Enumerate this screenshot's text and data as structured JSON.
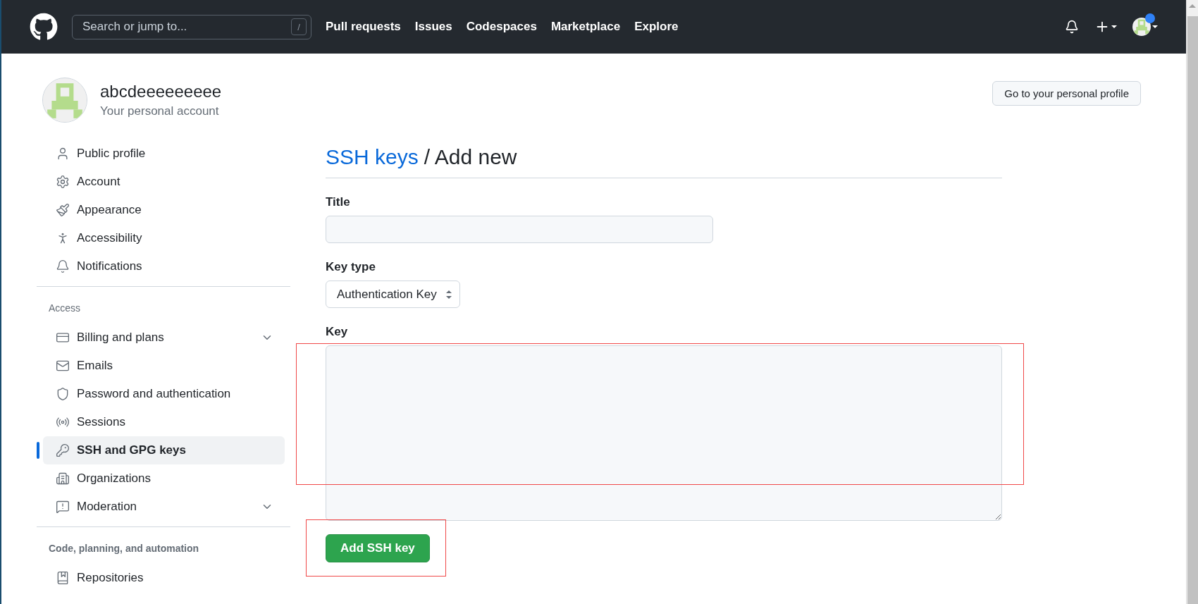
{
  "header": {
    "search": {
      "placeholder": "Search or jump to...",
      "shortcut": "/"
    },
    "nav": [
      "Pull requests",
      "Issues",
      "Codespaces",
      "Marketplace",
      "Explore"
    ],
    "notification_dot": true
  },
  "account": {
    "name": "abcdeeeeeeeee",
    "subtitle": "Your personal account",
    "profile_button": "Go to your personal profile"
  },
  "sidebar": {
    "sections": [
      {
        "items": [
          {
            "label": "Public profile",
            "selected": false,
            "expandable": false
          },
          {
            "label": "Account",
            "selected": false,
            "expandable": false
          },
          {
            "label": "Appearance",
            "selected": false,
            "expandable": false
          },
          {
            "label": "Accessibility",
            "selected": false,
            "expandable": false
          },
          {
            "label": "Notifications",
            "selected": false,
            "expandable": false
          }
        ]
      },
      {
        "heading": "Access",
        "items": [
          {
            "label": "Billing and plans",
            "selected": false,
            "expandable": true
          },
          {
            "label": "Emails",
            "selected": false,
            "expandable": false
          },
          {
            "label": "Password and authentication",
            "selected": false,
            "expandable": false
          },
          {
            "label": "Sessions",
            "selected": false,
            "expandable": false
          },
          {
            "label": "SSH and GPG keys",
            "selected": true,
            "expandable": false
          },
          {
            "label": "Organizations",
            "selected": false,
            "expandable": false
          },
          {
            "label": "Moderation",
            "selected": false,
            "expandable": true
          }
        ]
      },
      {
        "heading": "Code, planning, and automation",
        "items": [
          {
            "label": "Repositories",
            "selected": false,
            "expandable": false
          }
        ]
      }
    ]
  },
  "form": {
    "breadcrumb_link": "SSH keys",
    "title": "/ Add new",
    "fields": [
      {
        "kind": "input",
        "label": "Title"
      },
      {
        "kind": "select",
        "label": "Key type",
        "value": "Authentication Key"
      },
      {
        "kind": "textarea",
        "label": "Key",
        "highlighted": true
      }
    ],
    "submit": {
      "label": "Add SSH key",
      "highlighted": true
    }
  }
}
